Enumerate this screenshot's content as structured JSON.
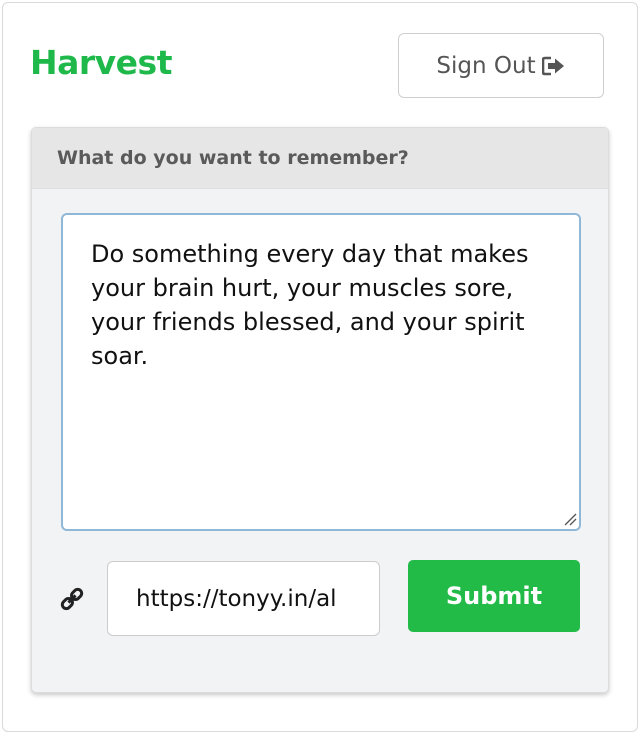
{
  "app": {
    "brand": "Harvest",
    "brand_color": "#1fb94b"
  },
  "header": {
    "signout_label": "Sign Out",
    "signout_icon": "sign-out-icon"
  },
  "card": {
    "title": "What do you want to remember?",
    "memo_text": "Do something every day that makes your brain hurt, your muscles sore, your friends blessed, and your spirit soar.",
    "url_value": "https://tonyy.in/al",
    "link_icon": "link-icon",
    "submit_label": "Submit",
    "submit_color": "#22bb48"
  }
}
